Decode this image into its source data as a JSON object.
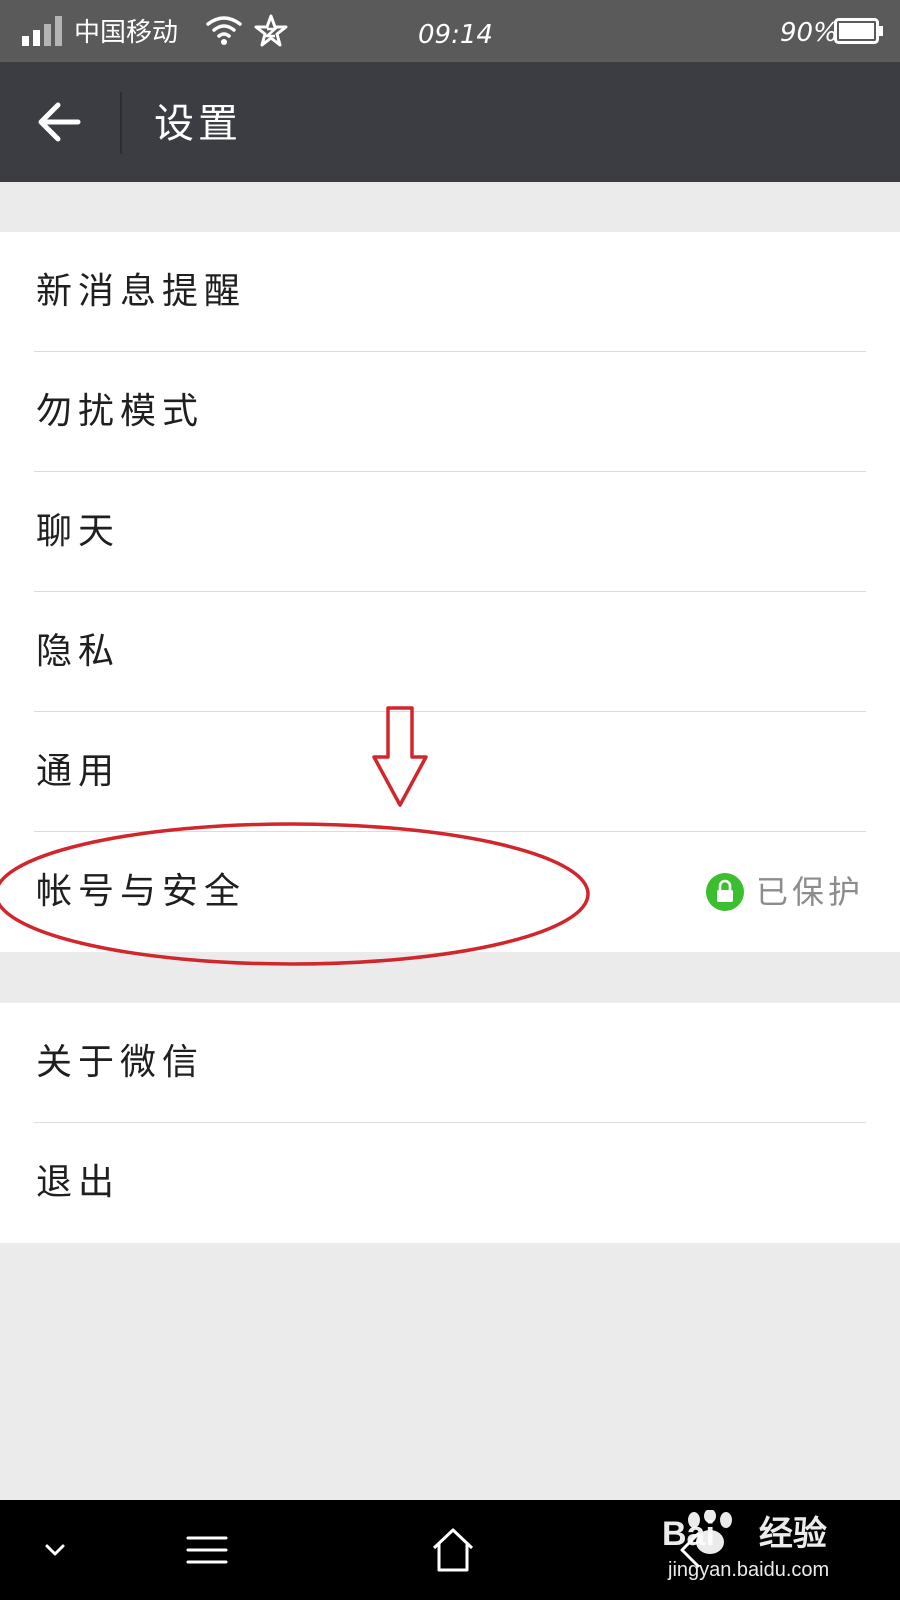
{
  "status_bar": {
    "carrier": "中国移动",
    "time": "09:14",
    "battery": "90%",
    "icons": [
      "signal-icon",
      "wifi-icon",
      "star-icon",
      "battery-icon"
    ]
  },
  "header": {
    "title": "设置",
    "back_icon": "arrow-left-icon"
  },
  "groups": [
    {
      "items": [
        {
          "label": "新消息提醒"
        },
        {
          "label": "勿扰模式"
        },
        {
          "label": "聊天"
        },
        {
          "label": "隐私"
        },
        {
          "label": "通用"
        },
        {
          "label": "帐号与安全",
          "status": "已保护",
          "status_icon": "lock-icon"
        }
      ]
    },
    {
      "items": [
        {
          "label": "关于微信"
        },
        {
          "label": "退出"
        }
      ]
    }
  ],
  "annotation": {
    "color": "#d0262c",
    "shapes": [
      "down-arrow",
      "ellipse"
    ]
  },
  "nav_bar": {
    "icons": [
      "chevron-down-icon",
      "menu-icon",
      "home-icon",
      "back-icon"
    ]
  },
  "watermark": {
    "brand_prefix": "Bai",
    "brand_suffix": "经验",
    "url": "jingyan.baidu.com"
  },
  "colors": {
    "title_bar": "#3b3d42",
    "status_bar": "#5a5a5a",
    "background": "#ebebeb",
    "accent_green": "#3cbf2e"
  }
}
